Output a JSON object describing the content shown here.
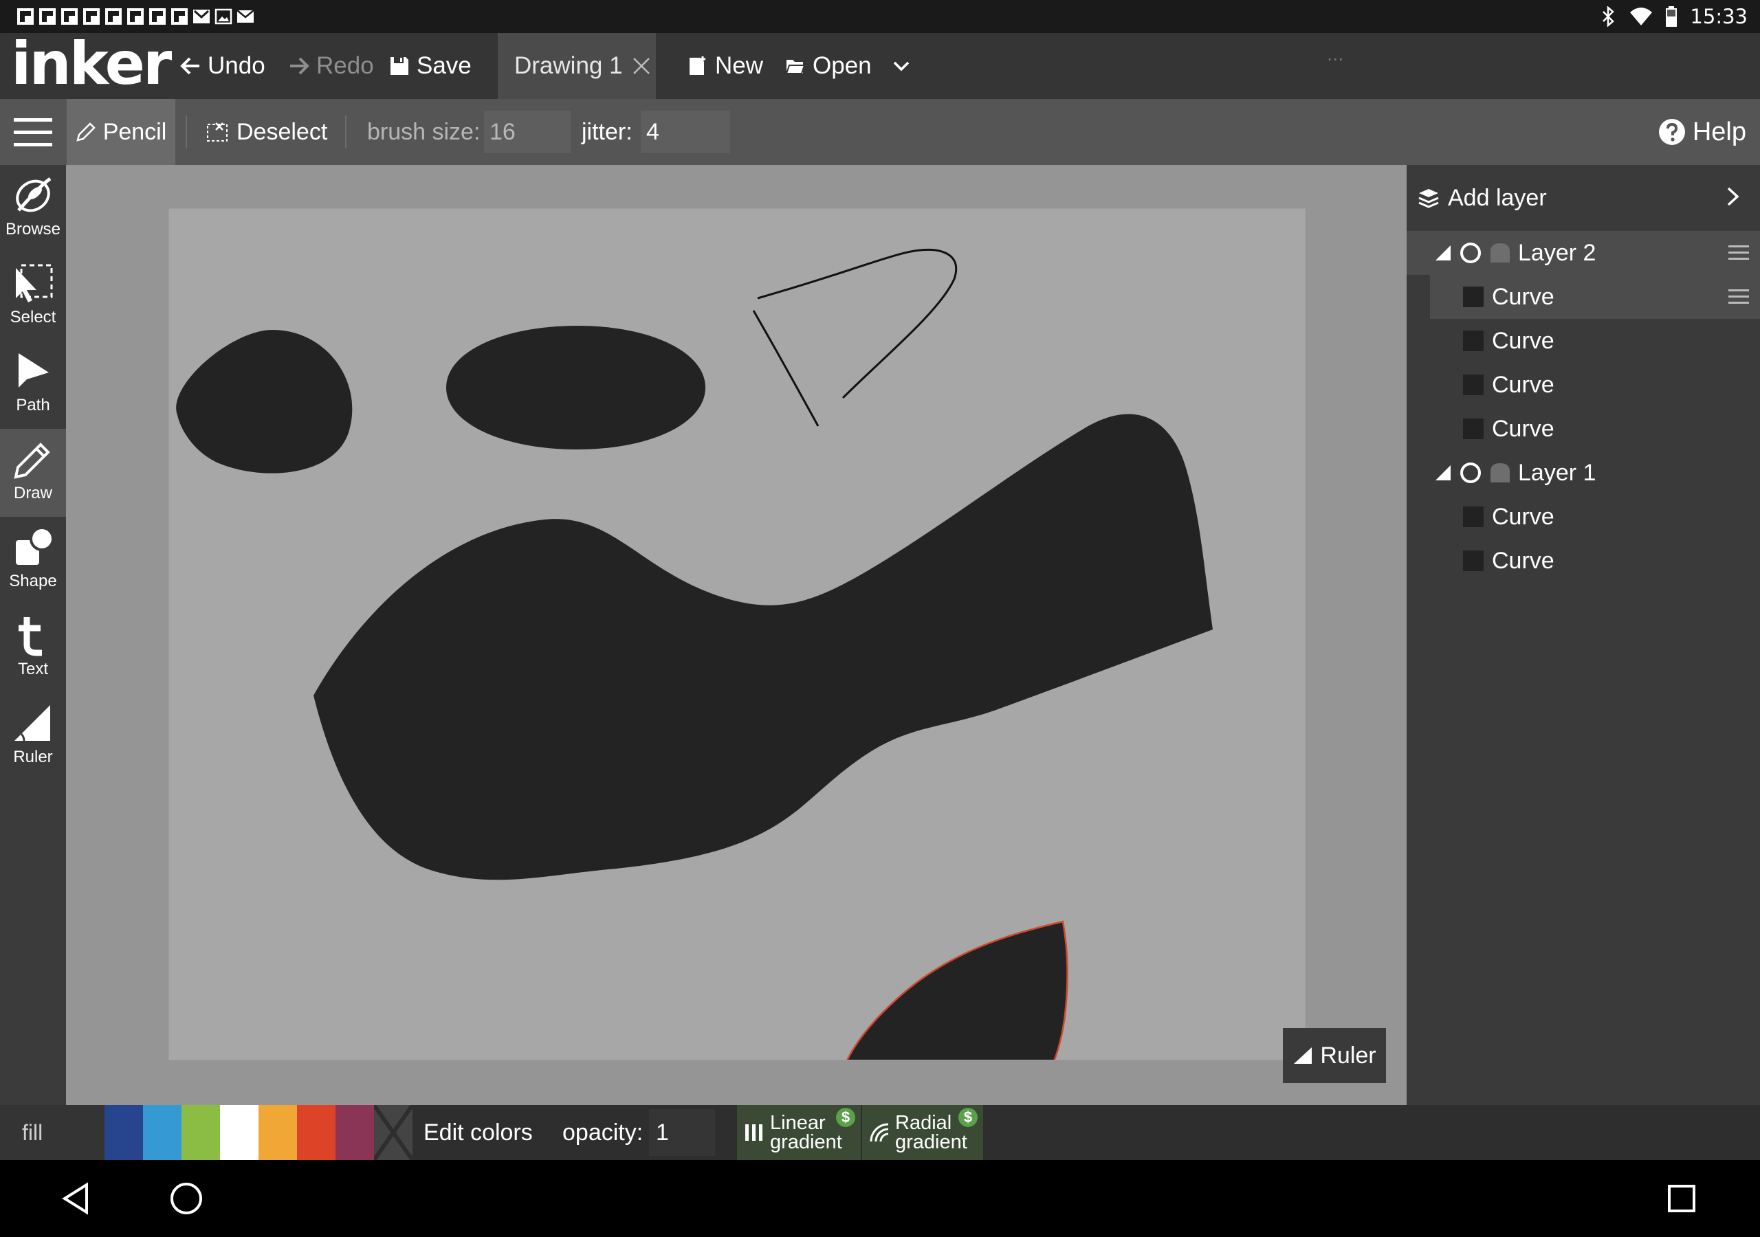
{
  "status_bar": {
    "time": "15:33",
    "notification_icons": [
      "flipboard-icon",
      "flipboard-icon",
      "flipboard-icon",
      "flipboard-icon",
      "flipboard-icon",
      "flipboard-icon",
      "flipboard-icon",
      "flipboard-icon",
      "gmail-icon",
      "image-icon",
      "mail-icon"
    ],
    "right_icons": [
      "bluetooth-icon",
      "wifi-icon",
      "battery-icon"
    ]
  },
  "app": {
    "logo": "inker",
    "undo_label": "Undo",
    "redo_label": "Redo",
    "save_label": "Save",
    "tab_label": "Drawing 1",
    "new_label": "New",
    "open_label": "Open"
  },
  "toolbar": {
    "pencil_label": "Pencil",
    "deselect_label": "Deselect",
    "brush_size_label": "brush size:",
    "brush_size_value": "16",
    "jitter_label": "jitter:",
    "jitter_value": "4",
    "help_label": "Help"
  },
  "tools": [
    {
      "label": "Browse",
      "icon": "browse-icon"
    },
    {
      "label": "Select",
      "icon": "select-icon"
    },
    {
      "label": "Path",
      "icon": "path-icon"
    },
    {
      "label": "Draw",
      "icon": "draw-icon",
      "active": true
    },
    {
      "label": "Shape",
      "icon": "shape-icon"
    },
    {
      "label": "Text",
      "icon": "text-icon"
    },
    {
      "label": "Ruler",
      "icon": "ruler-icon"
    }
  ],
  "canvas": {
    "ruler_label": "Ruler",
    "fill_color": "#232323",
    "selection_stroke": "#d0492c"
  },
  "layers": {
    "add_layer_label": "Add layer",
    "items": [
      {
        "name": "Layer 2",
        "curves": [
          "Curve",
          "Curve",
          "Curve",
          "Curve"
        ]
      },
      {
        "name": "Layer 1",
        "curves": [
          "Curve",
          "Curve"
        ]
      }
    ]
  },
  "colors": {
    "fill_label": "fill",
    "palette": [
      "#27448e",
      "#3599d3",
      "#8bbd45",
      "#ffffff",
      "#f0a735",
      "#dd4326",
      "#8a3456"
    ],
    "edit_colors_label": "Edit colors",
    "opacity_label": "opacity:",
    "opacity_value": "1",
    "linear_gradient": [
      "Linear",
      "gradient"
    ],
    "radial_gradient": [
      "Radial",
      "gradient"
    ],
    "premium_badge": "$"
  }
}
